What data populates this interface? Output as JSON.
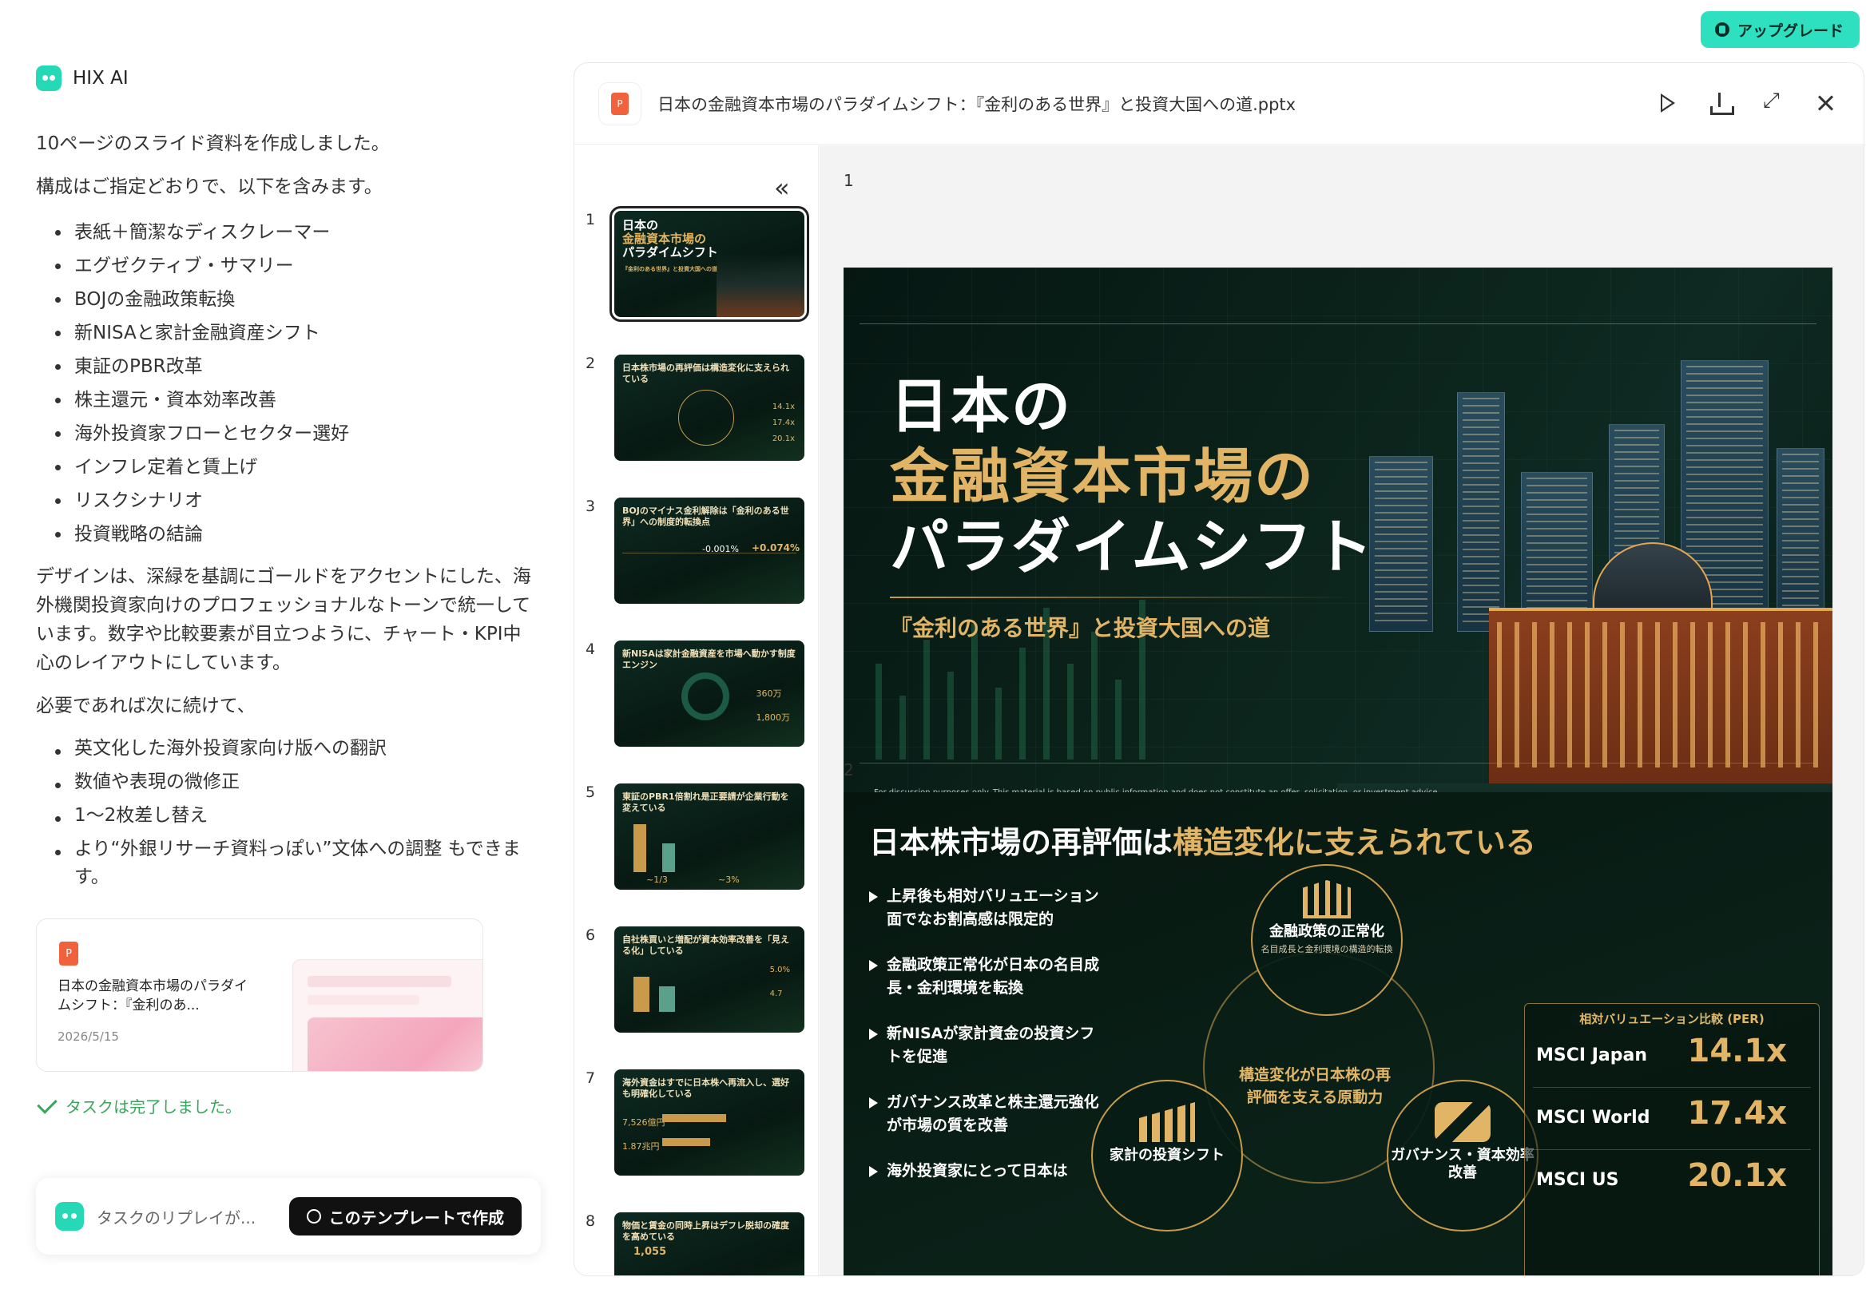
{
  "header": {
    "upgrade_label": "アップグレード"
  },
  "brand": {
    "name": "HIX AI"
  },
  "chat": {
    "intro": "10ページのスライド資料を作成しました。",
    "structure_intro": "構成はご指定どおりで、以下を含みます。",
    "structure_items": [
      "表紙＋簡潔なディスクレーマー",
      "エグゼクティブ・サマリー",
      "BOJの金融政策転換",
      "新NISAと家計金融資産シフト",
      "東証のPBR改革",
      "株主還元・資本効率改善",
      "海外投資家フローとセクター選好",
      "インフレ定着と賃上げ",
      "リスクシナリオ",
      "投資戦略の結論"
    ],
    "design_note": "デザインは、深緑を基調にゴールドをアクセントにした、海外機関投資家向けのプロフェッショナルなトーンで統一しています。数字や比較要素が目立つように、チャート・KPI中心のレイアウトにしています。",
    "next_intro": "必要であれば次に続けて、",
    "next_items": [
      "英文化した海外投資家向け版への翻訳",
      "数値や表現の微修正",
      "1〜2枚差し替え",
      "より“外銀リサーチ資料っぽい”文体への調整 もできます。"
    ]
  },
  "file_card": {
    "icon_letter": "P",
    "name": "日本の金融資本市場のパラダイムシフト：『金利のあ...",
    "date": "2026/5/15"
  },
  "task_status": "タスクは完了しました。",
  "replay": {
    "text": "タスクのリプレイが...",
    "template_button": "このテンプレートで作成"
  },
  "viewer": {
    "icon_letter": "P",
    "title": "日本の金融資本市場のパラダイムシフト：『金利のある世界』と投資大国への道.pptx",
    "icons": [
      "play-icon",
      "download-icon",
      "expand-icon",
      "close-icon"
    ]
  },
  "thumbnails": [
    {
      "num": "1",
      "title_lines": [
        "日本の",
        "金融資本市場の",
        "パラダイムシフト"
      ],
      "subtitle": "『金利のある世界』と投資大国への道"
    },
    {
      "num": "2",
      "title": "日本株市場の再評価は構造変化に支えられている",
      "stats": [
        "14.1x",
        "17.4x",
        "20.1x"
      ]
    },
    {
      "num": "3",
      "title": "BOJのマイナス金利解除は「金利のある世界」への制度的転換点",
      "stats": [
        "-0.001%",
        "+0.074%"
      ]
    },
    {
      "num": "4",
      "title": "新NISAは家計金融資産を市場へ動かす制度エンジン",
      "stats": [
        "360万",
        "1,800万"
      ]
    },
    {
      "num": "5",
      "title": "東証のPBR1倍割れ是正要請が企業行動を変えている",
      "stats": [
        "~1/3",
        "~3%"
      ]
    },
    {
      "num": "6",
      "title": "自社株買いと増配が資本効率改善を「見える化」している",
      "stats": [
        "5.0%",
        "4.7"
      ]
    },
    {
      "num": "7",
      "title": "海外資金はすでに日本株へ再流入し、選好も明確化している",
      "stats": [
        "7,526億円",
        "1.87兆円"
      ]
    },
    {
      "num": "8",
      "title": "物価と賃金の同時上昇はデフレ脱却の確度を高めている",
      "stats": [
        "1,055"
      ]
    }
  ],
  "slides": {
    "slide1": {
      "num": "1",
      "title_line1": "日本の",
      "title_line2": "金融資本市場の",
      "title_line3": "パラダイムシフト",
      "subtitle": "『金利のある世界』と投資大国への道",
      "disclaimer": "For discussion purposes only. This material is based on public information and does not constitute an offer, solicitation, or investment advice."
    },
    "slide2": {
      "num": "2",
      "title_white": "日本株市場の再評価は",
      "title_gold": "構造変化に支えられている",
      "bullets": [
        "上昇後も相対バリュエーション面でなお割高感は限定的",
        "金融政策正常化が日本の名目成長・金利環境を転換",
        "新NISAが家計資金の投資シフトを促進",
        "ガバナンス改革と株主還元強化が市場の質を改善",
        "海外投資家にとって日本は"
      ],
      "circle_top": {
        "label": "金融政策の正常化",
        "small": "名目成長と金利環境の構造的転換"
      },
      "circle_left": {
        "label": "家計の投資シフト"
      },
      "circle_right": {
        "label": "ガバナンス・資本効率改善"
      },
      "center_text": "構造変化が日本株の再評価を支える原動力",
      "per_title": "相対バリュエーション比較 (PER)",
      "per_rows": [
        {
          "name": "MSCI Japan",
          "value": "14.1x"
        },
        {
          "name": "MSCI World",
          "value": "17.4x"
        },
        {
          "name": "MSCI US",
          "value": "20.1x"
        }
      ]
    }
  }
}
